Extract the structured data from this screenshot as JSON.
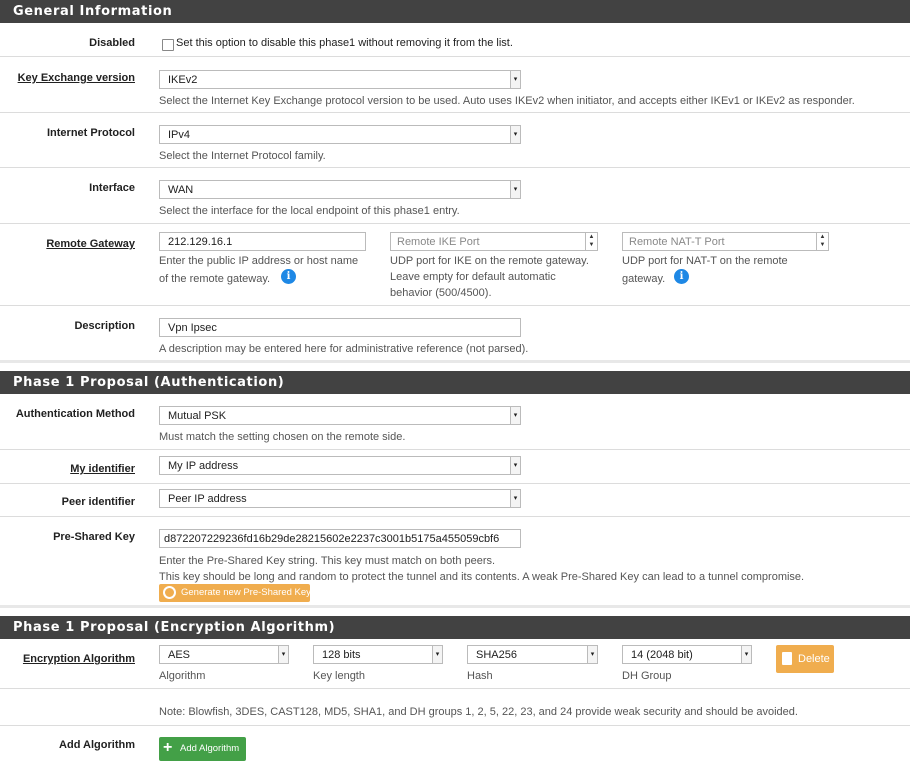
{
  "general": {
    "title": "General Information",
    "disabled": {
      "label": "Disabled",
      "text": "Set this option to disable this phase1 without removing it from the list."
    },
    "key_exchange": {
      "label": "Key Exchange version",
      "value": "IKEv2",
      "help": "Select the Internet Key Exchange protocol version to be used. Auto uses IKEv2 when initiator, and accepts either IKEv1 or IKEv2 as responder."
    },
    "protocol": {
      "label": "Internet Protocol",
      "value": "IPv4",
      "help": "Select the Internet Protocol family."
    },
    "interface": {
      "label": "Interface",
      "value": "WAN",
      "help": "Select the interface for the local endpoint of this phase1 entry."
    },
    "remote_gateway": {
      "label": "Remote Gateway",
      "value": "212.129.16.1",
      "help1": "Enter the public IP address or host name",
      "help2": "of the remote gateway.",
      "ike_placeholder": "Remote IKE Port",
      "ike_help1": "UDP port for IKE on the remote gateway.",
      "ike_help2": "Leave empty for default automatic",
      "ike_help3": "behavior (500/4500).",
      "natt_placeholder": "Remote NAT-T Port",
      "natt_help1": "UDP port for NAT-T on the remote",
      "natt_help2": "gateway."
    },
    "description": {
      "label": "Description",
      "value": "Vpn Ipsec",
      "help": "A description may be entered here for administrative reference (not parsed)."
    }
  },
  "auth": {
    "title": "Phase 1 Proposal (Authentication)",
    "method": {
      "label": "Authentication Method",
      "value": "Mutual PSK",
      "help": "Must match the setting chosen on the remote side."
    },
    "my_id": {
      "label": "My identifier",
      "value": "My IP address"
    },
    "peer_id": {
      "label": "Peer identifier",
      "value": "Peer IP address"
    },
    "psk": {
      "label": "Pre-Shared Key",
      "value": "d872207229236fd16b29de28215602e2237c3001b5175a455059cbf6",
      "help1": "Enter the Pre-Shared Key string. This key must match on both peers.",
      "help2": "This key should be long and random to protect the tunnel and its contents. A weak Pre-Shared Key can lead to a tunnel compromise.",
      "generate_button": "Generate new Pre-Shared Key"
    }
  },
  "encryption": {
    "title": "Phase 1 Proposal (Encryption Algorithm)",
    "label": "Encryption Algorithm",
    "algorithm": {
      "value": "AES",
      "caption": "Algorithm"
    },
    "key_length": {
      "value": "128 bits",
      "caption": "Key length"
    },
    "hash": {
      "value": "SHA256",
      "caption": "Hash"
    },
    "dh_group": {
      "value": "14 (2048 bit)",
      "caption": "DH Group"
    },
    "delete_button": "Delete",
    "note": "Note: Blowfish, 3DES, CAST128, MD5, SHA1, and DH groups 1, 2, 5, 22, 23, and 24 provide weak security and should be avoided.",
    "add_label": "Add Algorithm",
    "add_button": "Add Algorithm"
  },
  "colors": {
    "header": "#424242",
    "accent_orange": "#f0ad4e",
    "accent_green": "#43a047",
    "info_blue": "#1e88e5"
  }
}
